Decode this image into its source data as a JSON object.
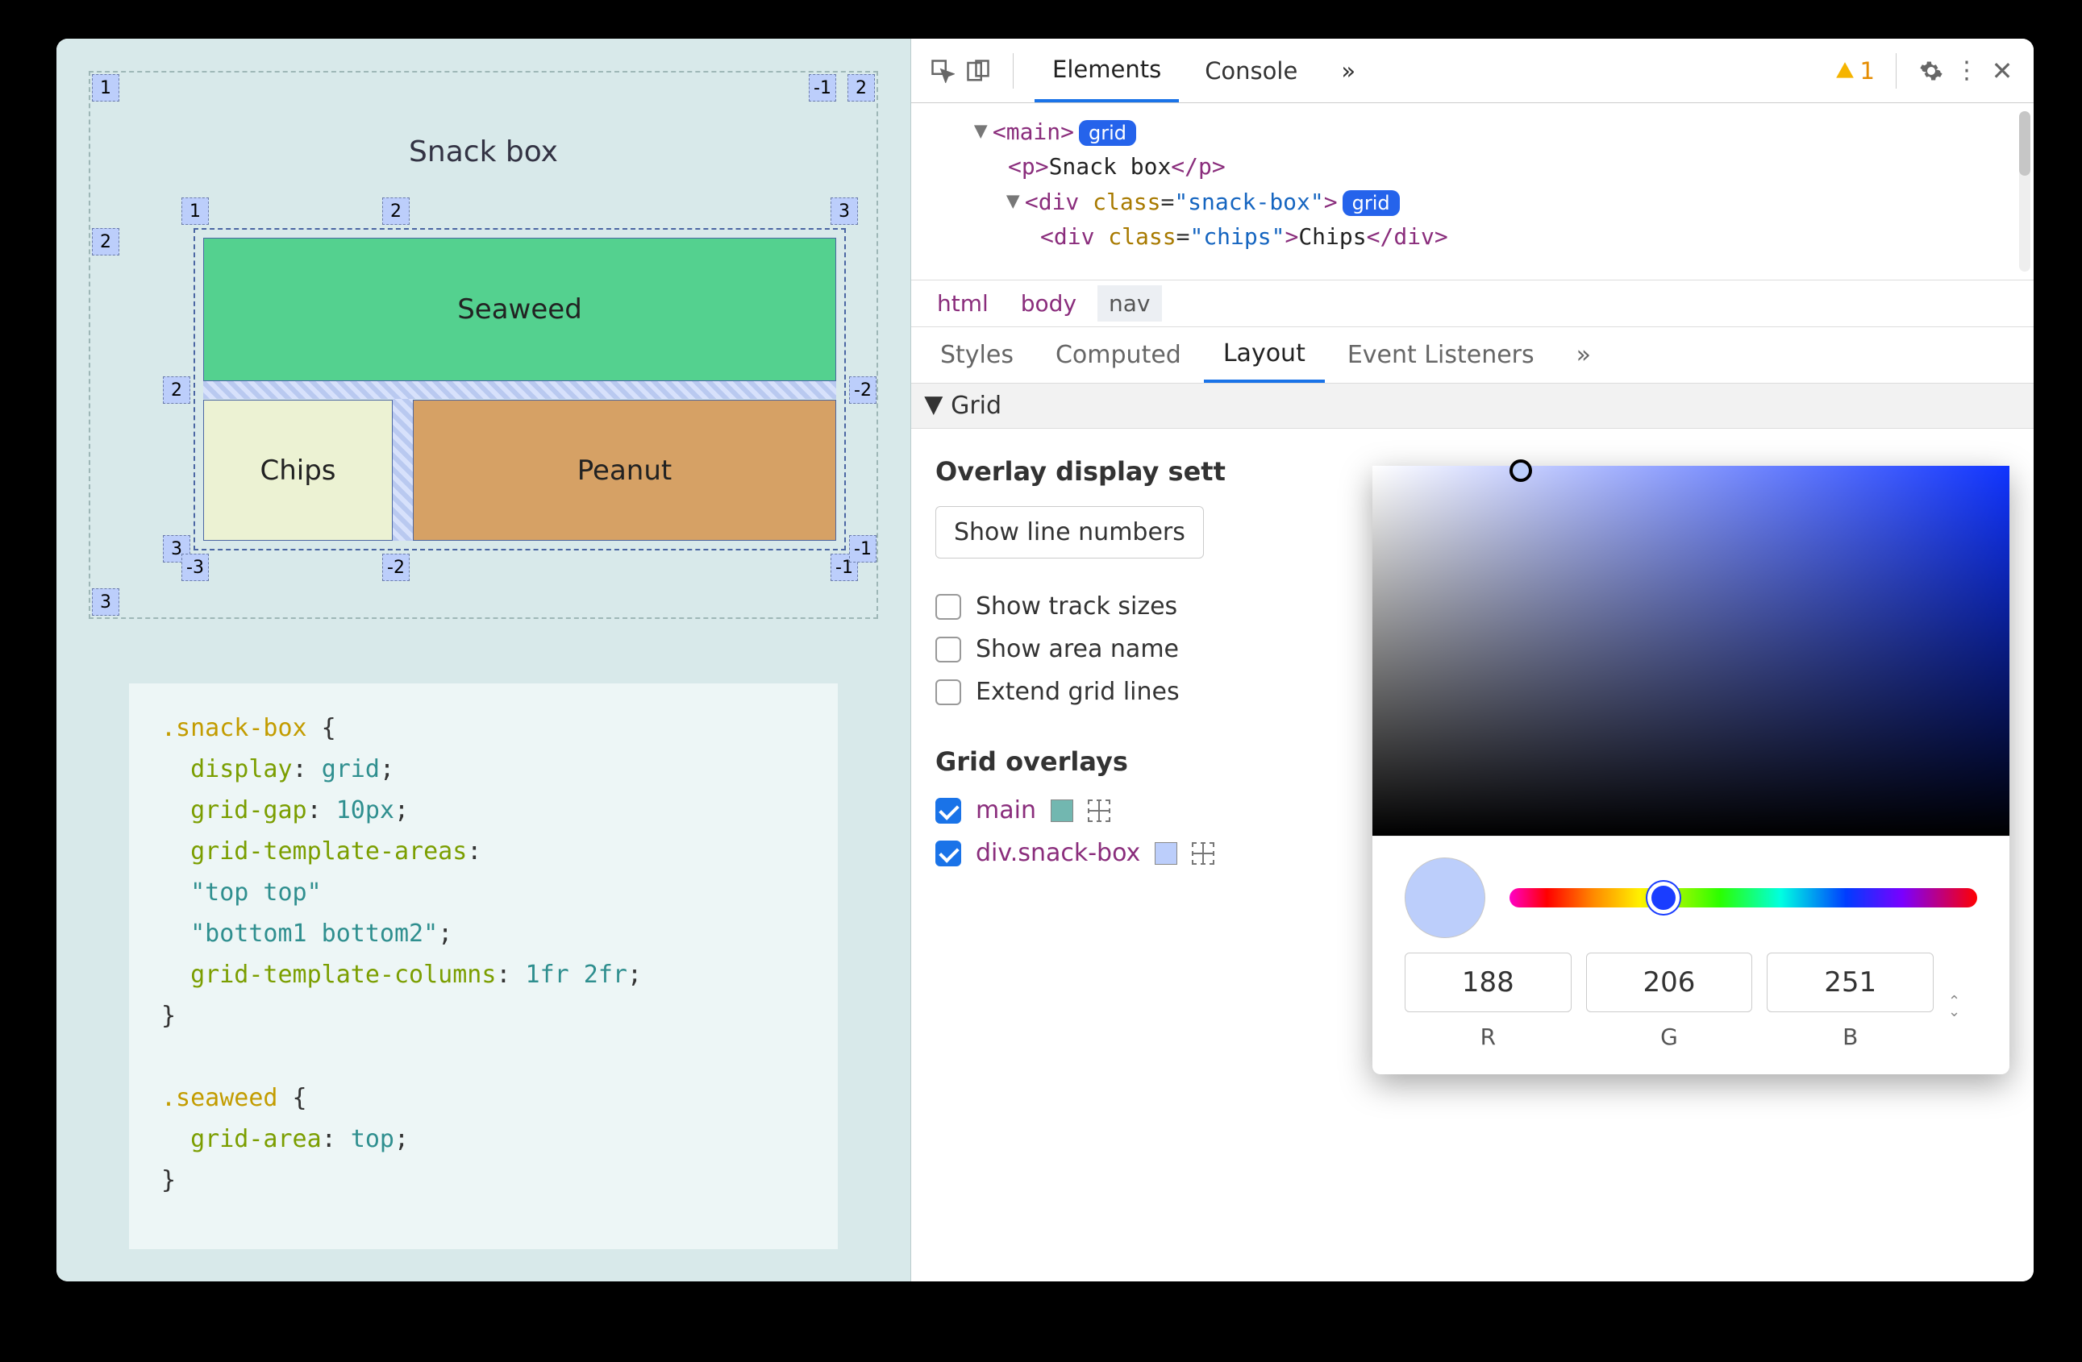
{
  "demo": {
    "title": "Snack box",
    "items": {
      "seaweed": "Seaweed",
      "chips": "Chips",
      "peanut": "Peanut"
    },
    "outer_labels": {
      "tl": "1",
      "tr_neg": "-1",
      "tr": "2",
      "ml": "2",
      "bl": "3"
    },
    "inner_labels": {
      "t1": "1",
      "t2": "2",
      "t3": "3",
      "l2": "2",
      "r_neg2": "-2",
      "b3": "3",
      "b_neg3": "-3",
      "b_neg2": "-2",
      "b_neg1": "-1",
      "r_neg1": "-1"
    }
  },
  "code": {
    "sel1": ".snack-box",
    "l1": "display",
    "v1": "grid",
    "l2": "grid-gap",
    "v2": "10px",
    "l3": "grid-template-areas",
    "v3a": "\"top top\"",
    "v3b": "\"bottom1 bottom2\"",
    "l4": "grid-template-columns",
    "v4": "1fr 2fr",
    "sel2": ".seaweed",
    "l5": "grid-area",
    "v5": "top"
  },
  "toolbar": {
    "elements": "Elements",
    "console": "Console",
    "warn_count": "1"
  },
  "dom": {
    "main_tag": "main",
    "main_badge": "grid",
    "p_text": "Snack box",
    "div_class": "snack-box",
    "div_badge": "grid",
    "chips_class": "chips",
    "chips_text": "Chips"
  },
  "crumbs": {
    "c1": "html",
    "c2": "body",
    "c3": "nav"
  },
  "subtabs": {
    "styles": "Styles",
    "computed": "Computed",
    "layout": "Layout",
    "events": "Event Listeners"
  },
  "grid_section": "Grid",
  "overlay": {
    "heading": "Overlay display sett",
    "select": "Show line numbers",
    "opt1": "Show track sizes",
    "opt2": "Show area name",
    "opt3": "Extend grid lines"
  },
  "overlays_heading": "Grid overlays",
  "ov_main": "main",
  "ov_div": "div.snack-box",
  "picker": {
    "r": "188",
    "g": "206",
    "b": "251",
    "R": "R",
    "G": "G",
    "B": "B"
  }
}
